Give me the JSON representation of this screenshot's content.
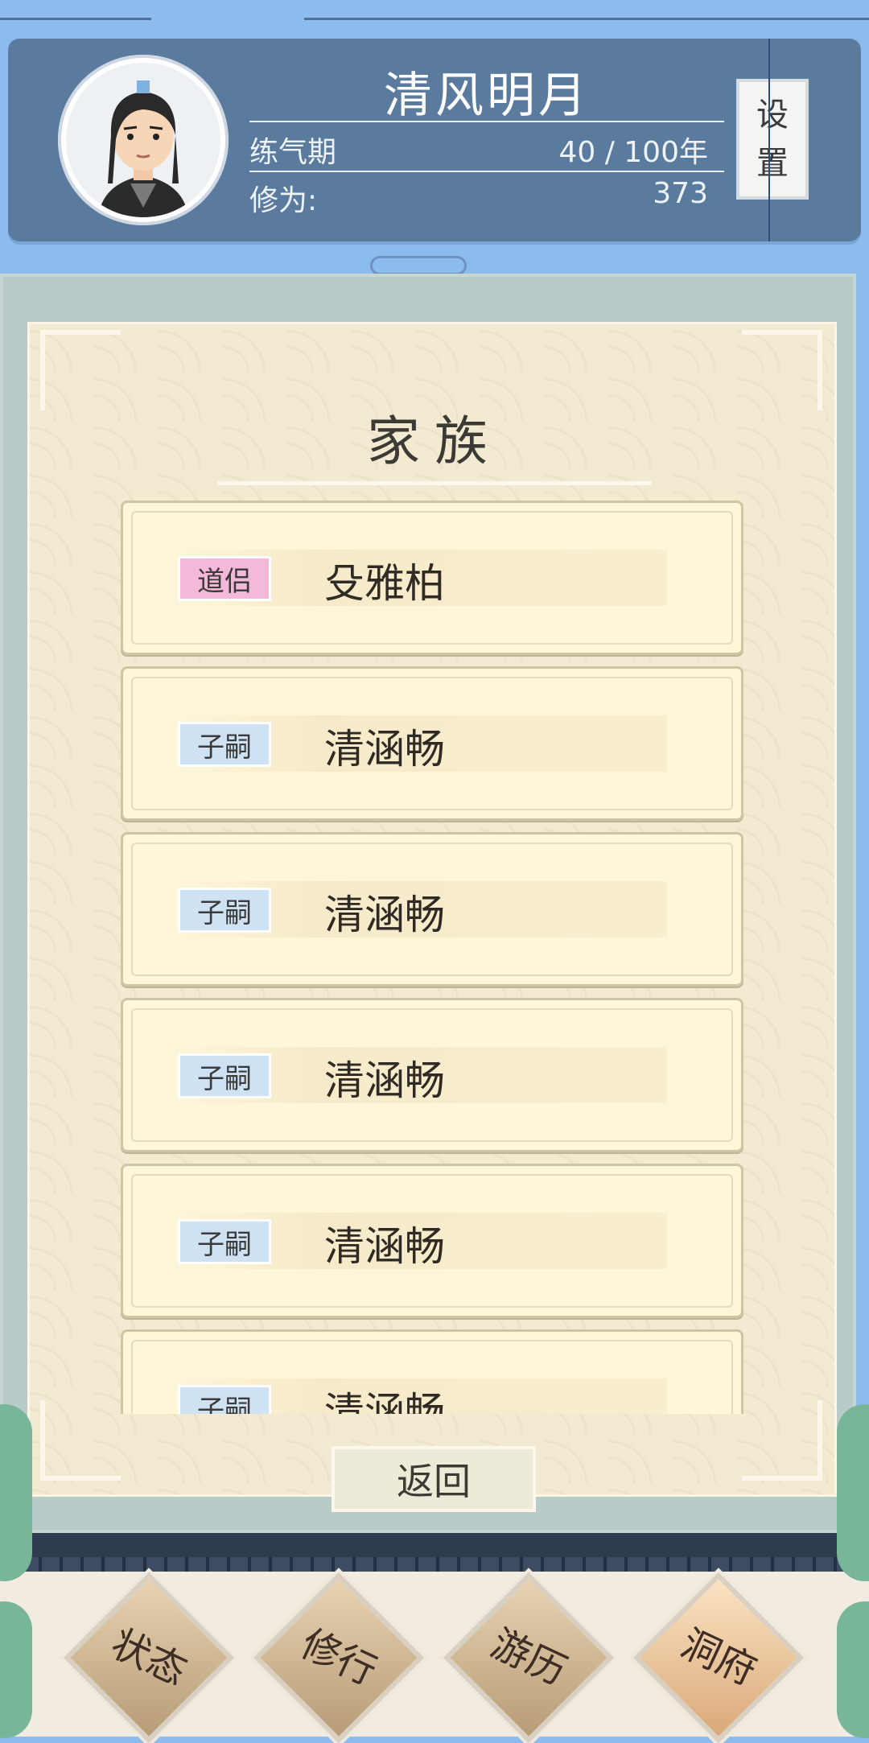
{
  "header": {
    "player_name": "清风明月",
    "realm_label": "练气期",
    "realm_value": "40 / 100年",
    "cultivation_label": "修为:",
    "cultivation_value": "373",
    "settings_label_1": "设",
    "settings_label_2": "置"
  },
  "panel": {
    "title": "家族",
    "members": [
      {
        "tag": "道侣",
        "tag_color": "#f4b9d8",
        "name": "殳雅柏"
      },
      {
        "tag": "子嗣",
        "tag_color": "#cfe2f3",
        "name": "清涵畅"
      },
      {
        "tag": "子嗣",
        "tag_color": "#cfe2f3",
        "name": "清涵畅"
      },
      {
        "tag": "子嗣",
        "tag_color": "#cfe2f3",
        "name": "清涵畅"
      },
      {
        "tag": "子嗣",
        "tag_color": "#cfe2f3",
        "name": "清涵畅"
      },
      {
        "tag": "子嗣",
        "tag_color": "#cfe2f3",
        "name": "清涵畅"
      }
    ],
    "back_label": "返回"
  },
  "nav": {
    "items": [
      {
        "label": "状态"
      },
      {
        "label": "修行"
      },
      {
        "label": "游历"
      },
      {
        "label": "洞府"
      }
    ]
  }
}
